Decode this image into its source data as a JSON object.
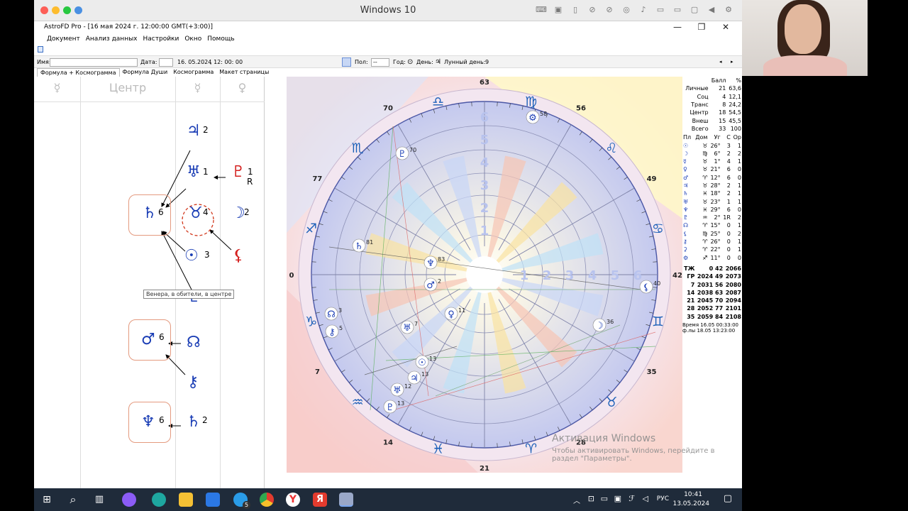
{
  "vm": {
    "title": "Windows 10",
    "mac_dots": [
      "#fd5f57",
      "#fdbc2e",
      "#28c840",
      "#4a90e2"
    ],
    "toolbar_icons": [
      "keyboard-icon",
      "chip-icon",
      "usb-icon",
      "camera-off-icon",
      "globe-off-icon",
      "network-icon",
      "mic-icon",
      "drive-icon",
      "video-icon",
      "folder-share-icon",
      "play-icon",
      "gear-icon"
    ]
  },
  "app": {
    "title": "AstroFD Pro - [16 мая 2024 г. 12:00:00 GMT(+3:00)]",
    "menu": [
      "Документ",
      "Анализ данных",
      "Настройки",
      "Окно",
      "Помощь"
    ],
    "win_controls": [
      "—",
      "❐",
      "✕"
    ]
  },
  "toolbar": {
    "name_label": "Имя:",
    "name_value": "",
    "date_label": "Дата:",
    "date_value": "16. 05.2024",
    "time_value": ", 12: 00: 00",
    "gender_label": "Пол:",
    "gender_value": "--",
    "year_label": "Год:",
    "day_label": "День:",
    "lunar_day_label": "Лунный день:",
    "lunar_day_value": "9"
  },
  "tabs": [
    "Формула + Космограмма",
    "Формула Души",
    "Космограмма",
    "Макет страницы"
  ],
  "formula": {
    "headers": [
      "☿",
      "Центр",
      "☿",
      "♀"
    ],
    "tooltip": "Венера, в обители, в центре",
    "glyphs": [
      {
        "sym": "♃",
        "num": "2"
      },
      {
        "sym": "♅",
        "num": "1"
      },
      {
        "sym": "♇",
        "num": "1"
      },
      {
        "sym": "R",
        "num": ""
      },
      {
        "sym": "♄",
        "num": "6"
      },
      {
        "sym": "♉",
        "num": "4"
      },
      {
        "sym": "☽",
        "num": "2"
      },
      {
        "sym": "☉",
        "num": "3"
      },
      {
        "sym": "⚸",
        "num": ""
      },
      {
        "sym": "♇",
        "num": ""
      },
      {
        "sym": "♂",
        "num": "6"
      },
      {
        "sym": "☊",
        "num": ""
      },
      {
        "sym": "⚷",
        "num": ""
      },
      {
        "sym": "♆",
        "num": "6"
      },
      {
        "sym": "♄",
        "num": "2"
      }
    ]
  },
  "chart": {
    "signs": [
      "♈",
      "♉",
      "♊",
      "♋",
      "♌",
      "♍",
      "♎",
      "♏",
      "♐",
      "♑",
      "♒",
      "♓"
    ],
    "degree_labels": [
      "63",
      "56",
      "49",
      "42",
      "35",
      "28",
      "21",
      "14",
      "7",
      "0",
      "77",
      "70"
    ],
    "ring_numbers": [
      "1",
      "2",
      "3",
      "4",
      "5",
      "6"
    ],
    "planets": [
      {
        "sym": "⚙",
        "num": "58"
      },
      {
        "sym": "♇",
        "num": "70"
      },
      {
        "sym": "♄",
        "num": "81"
      },
      {
        "sym": "♆",
        "num": "83"
      },
      {
        "sym": "♂",
        "num": "2"
      },
      {
        "sym": "♀",
        "num": "11"
      },
      {
        "sym": "♅",
        "num": "7"
      },
      {
        "sym": "☊",
        "num": "3"
      },
      {
        "sym": "⚷",
        "num": "5"
      },
      {
        "sym": "☉",
        "num": "13"
      },
      {
        "sym": "♃",
        "num": "13"
      },
      {
        "sym": "♅",
        "num": "12"
      },
      {
        "sym": "♇",
        "num": "13"
      },
      {
        "sym": "☽",
        "num": "36"
      },
      {
        "sym": "⚸",
        "num": "40"
      }
    ]
  },
  "scores": {
    "header": [
      "",
      "Балл",
      "%"
    ],
    "rows": [
      [
        "Личные",
        "21",
        "63,6"
      ],
      [
        "Соц",
        "4",
        "12,1"
      ],
      [
        "Транс",
        "8",
        "24,2"
      ],
      [
        "Центр",
        "18",
        "54,5"
      ],
      [
        "Внеш",
        "15",
        "45,5"
      ],
      [
        "Всего",
        "33",
        "100"
      ]
    ],
    "planet_header": [
      "Пл",
      "Дом",
      "Уг",
      "С",
      "Ор"
    ],
    "planet_rows": [
      [
        "☉",
        "♉",
        "26°",
        "3",
        "1"
      ],
      [
        "☽",
        "♍",
        "6°",
        "2",
        "2"
      ],
      [
        "☿",
        "♉",
        "1°",
        "4",
        "1"
      ],
      [
        "♀",
        "♉",
        "21°",
        "6",
        "0"
      ],
      [
        "♂",
        "♈",
        "12°",
        "6",
        "0"
      ],
      [
        "♃",
        "♉",
        "28°",
        "2",
        "1"
      ],
      [
        "♄",
        "♓",
        "18°",
        "2",
        "1"
      ],
      [
        "♅",
        "♉",
        "23°",
        "1",
        "1"
      ],
      [
        "♆",
        "♓",
        "29°",
        "6",
        "0"
      ],
      [
        "♇",
        "♒",
        "2°",
        "1R",
        "2"
      ],
      [
        "☊",
        "♈",
        "15°",
        "0",
        "1"
      ],
      [
        "⚸",
        "♍",
        "25°",
        "0",
        "2"
      ],
      [
        "⚷",
        "♈",
        "26°",
        "0",
        "1"
      ],
      [
        "⚳",
        "♈",
        "22°",
        "0",
        "1"
      ],
      [
        "⚙",
        "♐",
        "11°",
        "0",
        "0"
      ]
    ],
    "year_rows": [
      [
        "ТЖ",
        "0",
        "42",
        "2066"
      ],
      [
        "ГР",
        "2024",
        "49",
        "2073"
      ],
      [
        "7",
        "2031",
        "56",
        "2080"
      ],
      [
        "14",
        "2038",
        "63",
        "2087"
      ],
      [
        "21",
        "2045",
        "70",
        "2094"
      ],
      [
        "28",
        "2052",
        "77",
        "2101"
      ],
      [
        "35",
        "2059",
        "84",
        "2108"
      ]
    ],
    "time_label": "Время",
    "time_value": "16.05 00:33:00",
    "file_label": "ф.лы",
    "file_value": "18.05 13:23:00"
  },
  "activation": {
    "title": "Активация Windows",
    "line1": "Чтобы активировать Windows, перейдите в",
    "line2": "раздел \"Параметры\"."
  },
  "taskbar": {
    "lang": "РУС",
    "time": "10:41",
    "date": "13.05.2024",
    "badge": "5"
  }
}
